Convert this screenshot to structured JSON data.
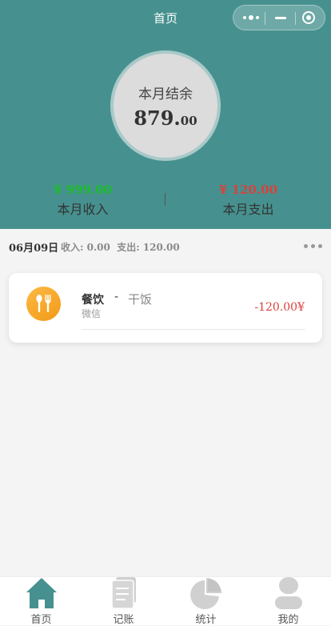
{
  "nav": {
    "title": "首页"
  },
  "balance": {
    "label": "本月结余",
    "amount_int": "879.",
    "amount_dec": "00"
  },
  "summary": {
    "income": {
      "value": "¥ 999.00",
      "label": "本月收入"
    },
    "expense": {
      "value": "¥ 120.00",
      "label": "本月支出"
    }
  },
  "day": {
    "date": "06月09日",
    "stats": "收入: 0.00  支出: 120.00"
  },
  "records": [
    {
      "category": "餐饮",
      "dash": "-",
      "note": "干饭",
      "method": "微信",
      "amount": "-120.00¥"
    }
  ],
  "tabs": [
    {
      "label": "首页",
      "icon": "home-icon",
      "active": true
    },
    {
      "label": "记账",
      "icon": "ledger-icon",
      "active": false
    },
    {
      "label": "统计",
      "icon": "pie-chart-icon",
      "active": false
    },
    {
      "label": "我的",
      "icon": "user-icon",
      "active": false
    }
  ],
  "colors": {
    "header": "#46918f",
    "income": "#1dbd2a",
    "expense": "#d9423c",
    "tab_active": "#46918f",
    "tab_inactive": "#cccccc",
    "category_icon": "#f5a623"
  }
}
